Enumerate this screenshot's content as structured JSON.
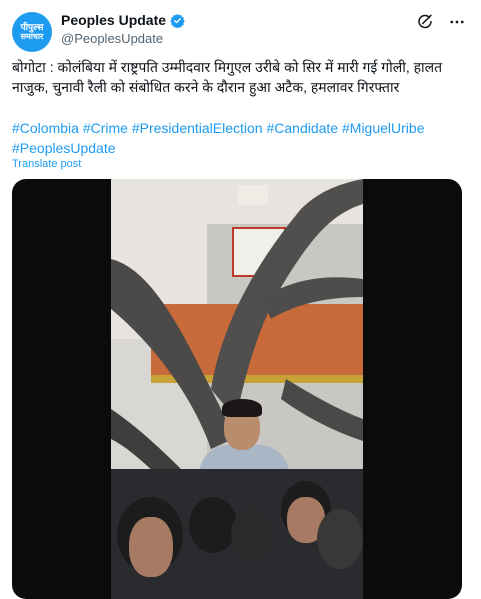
{
  "author": {
    "avatar_line1": "पीपुल्स",
    "avatar_line2": "समाचार",
    "display_name": "Peoples Update",
    "handle": "@PeoplesUpdate",
    "verified": true
  },
  "actions": {
    "grok_icon": "grok-icon",
    "more_icon": "more-icon"
  },
  "post": {
    "text": "बोगोटा : कोलंबिया में राष्ट्रपति उम्मीदवार मिगुएल उरीबे को सिर में मारी गई गोली, हालत नाजुक, चुनावी रैली को संबोधित करने के दौरान हुआ अटैक, हमलावर गिरफ्तार",
    "hashtags": [
      "#Colombia",
      "#Crime",
      "#PresidentialElection",
      "#Candidate",
      "#MiguelUribe",
      "#PeoplesUpdate"
    ],
    "translate_label": "Translate post"
  },
  "colors": {
    "accent": "#1d9bf0",
    "text": "#0f1419",
    "secondary": "#536471"
  }
}
